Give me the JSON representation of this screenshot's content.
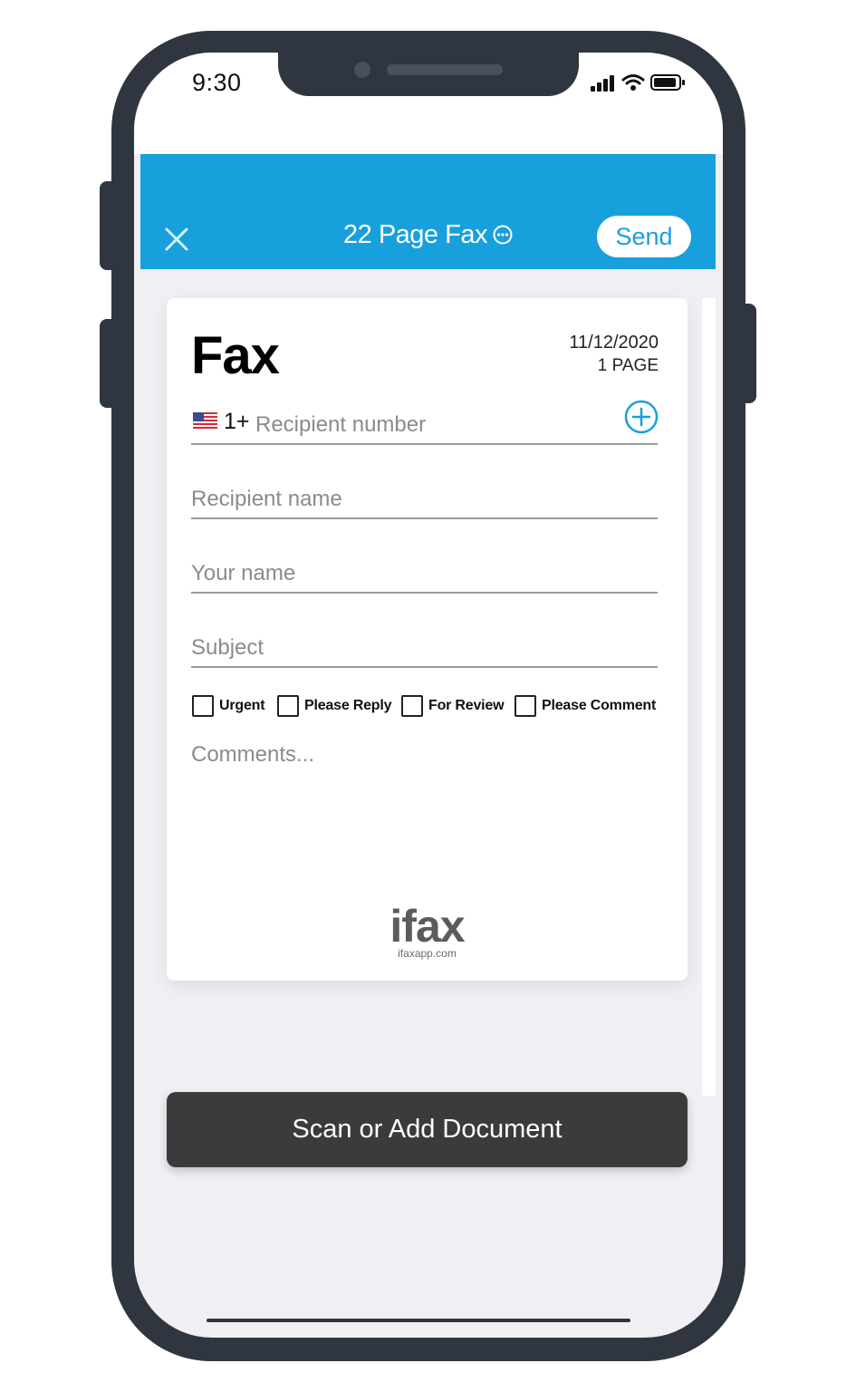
{
  "status_bar": {
    "time": "9:30",
    "icons": [
      "signal-icon",
      "wifi-icon",
      "battery-icon"
    ]
  },
  "header": {
    "title": "22 Page Fax",
    "send_label": "Send",
    "accent_color": "#18a0dc"
  },
  "cover": {
    "title": "Fax",
    "date": "11/12/2020",
    "pages": "1 PAGE",
    "country_code": "1+",
    "recipient_number_placeholder": "Recipient number",
    "recipient_name_placeholder": "Recipient name",
    "your_name_placeholder": "Your name",
    "subject_placeholder": "Subject",
    "checkboxes": [
      {
        "label": "Urgent",
        "checked": false
      },
      {
        "label": "Please Reply",
        "checked": false
      },
      {
        "label": "For Review",
        "checked": false
      },
      {
        "label": "Please Comment",
        "checked": false
      }
    ],
    "comments_placeholder": "Comments...",
    "logo_word": "ifax",
    "logo_url": "ifaxapp.com"
  },
  "footer": {
    "scan_label": "Scan or Add Document"
  }
}
